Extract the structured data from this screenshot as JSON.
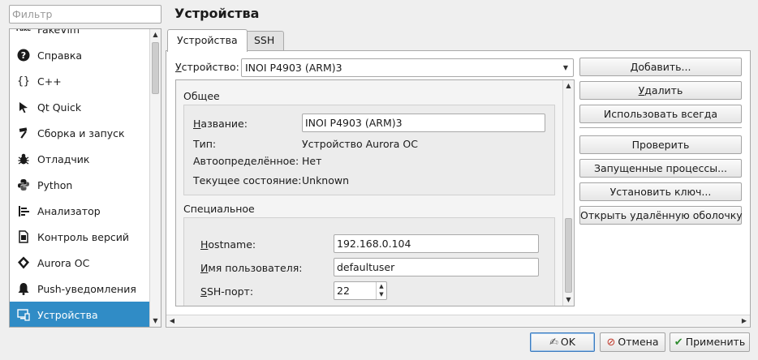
{
  "filter": {
    "placeholder": "Фильтр"
  },
  "nav": {
    "items": [
      {
        "label": "FakeVim",
        "icon": "fakevim-icon"
      },
      {
        "label": "Справка",
        "icon": "help-icon"
      },
      {
        "label": "C++",
        "icon": "braces-icon"
      },
      {
        "label": "Qt Quick",
        "icon": "qtquick-icon"
      },
      {
        "label": "Сборка и запуск",
        "icon": "hammer-icon"
      },
      {
        "label": "Отладчик",
        "icon": "bug-icon"
      },
      {
        "label": "Python",
        "icon": "python-icon"
      },
      {
        "label": "Анализатор",
        "icon": "analyzer-icon"
      },
      {
        "label": "Контроль версий",
        "icon": "version-control-icon"
      },
      {
        "label": "Aurora OC",
        "icon": "aurora-icon"
      },
      {
        "label": "Push-уведомления",
        "icon": "bell-icon"
      },
      {
        "label": "Устройства",
        "icon": "devices-icon",
        "selected": true
      }
    ],
    "selected_color": "#308cc6"
  },
  "page": {
    "title": "Устройства"
  },
  "tabs": [
    {
      "label": "Устройства",
      "active": true
    },
    {
      "label": "SSH",
      "active": false
    }
  ],
  "device": {
    "label": "Устройство:",
    "selected": "INOI P4903 (ARM)3"
  },
  "general": {
    "title": "Общее",
    "name_label": "Название:",
    "name_value": "INOI P4903 (ARM)3",
    "type_label": "Тип:",
    "type_value": "Устройство Aurora OC",
    "auto_label": "Автоопределённое:",
    "auto_value": "Нет",
    "state_label": "Текущее состояние:",
    "state_value": "Unknown"
  },
  "special": {
    "title": "Специальное",
    "hostname_label": "Hostname:",
    "hostname_value": "192.168.0.104",
    "user_label": "Имя пользователя:",
    "user_value": "defaultuser",
    "port_label": "SSH-порт:",
    "port_value": "22"
  },
  "side_buttons": {
    "add": "Добавить...",
    "remove": "Удалить",
    "default": "Использовать всегда",
    "test": "Проверить",
    "processes": "Запущенные процессы...",
    "key": "Установить ключ...",
    "shell": "Открыть удалённую оболочку"
  },
  "dialog": {
    "ok": "OK",
    "cancel": "Отмена",
    "apply": "Применить"
  }
}
